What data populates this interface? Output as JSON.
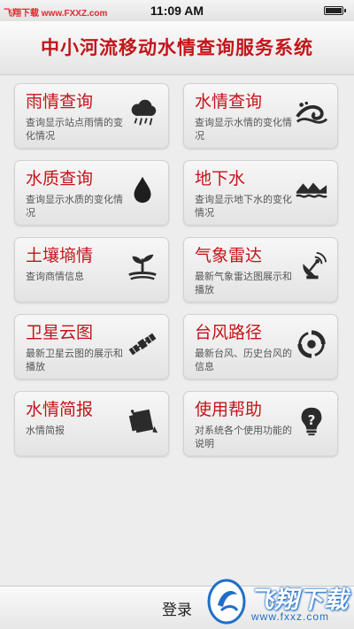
{
  "status_bar": {
    "watermark": "飞翔下载 www.FXXZ.com",
    "time": "11:09 AM"
  },
  "header": {
    "title": "中小河流移动水情查询服务系统"
  },
  "menu": [
    {
      "title": "雨情查询",
      "desc": "查询显示站点雨情的变化情况",
      "icon": "rain-cloud-icon"
    },
    {
      "title": "水情查询",
      "desc": "查询显示水情的变化情况",
      "icon": "water-wave-icon"
    },
    {
      "title": "水质查询",
      "desc": "查询显示水质的变化情况",
      "icon": "water-drop-icon"
    },
    {
      "title": "地下水",
      "desc": "查询显示地下水的变化情况",
      "icon": "groundwater-icon"
    },
    {
      "title": "土壤墒情",
      "desc": "查询商情信息",
      "icon": "sprout-icon"
    },
    {
      "title": "气象雷达",
      "desc": "最新气象雷达图展示和播放",
      "icon": "radar-dish-icon"
    },
    {
      "title": "卫星云图",
      "desc": "最新卫星云图的展示和播放",
      "icon": "satellite-icon"
    },
    {
      "title": "台风路径",
      "desc": "最新台风、历史台风的信息",
      "icon": "typhoon-icon"
    },
    {
      "title": "水情简报",
      "desc": "水情简报",
      "icon": "briefing-icon"
    },
    {
      "title": "使用帮助",
      "desc": "对系统各个使用功能的说明",
      "icon": "help-icon"
    }
  ],
  "bottom": {
    "login_label": "登录"
  },
  "watermark": {
    "brand": "飞翔下载",
    "url": "www.fxxz.com"
  },
  "colors": {
    "accent": "#c4141a",
    "watermark": "#1f6fc8"
  }
}
